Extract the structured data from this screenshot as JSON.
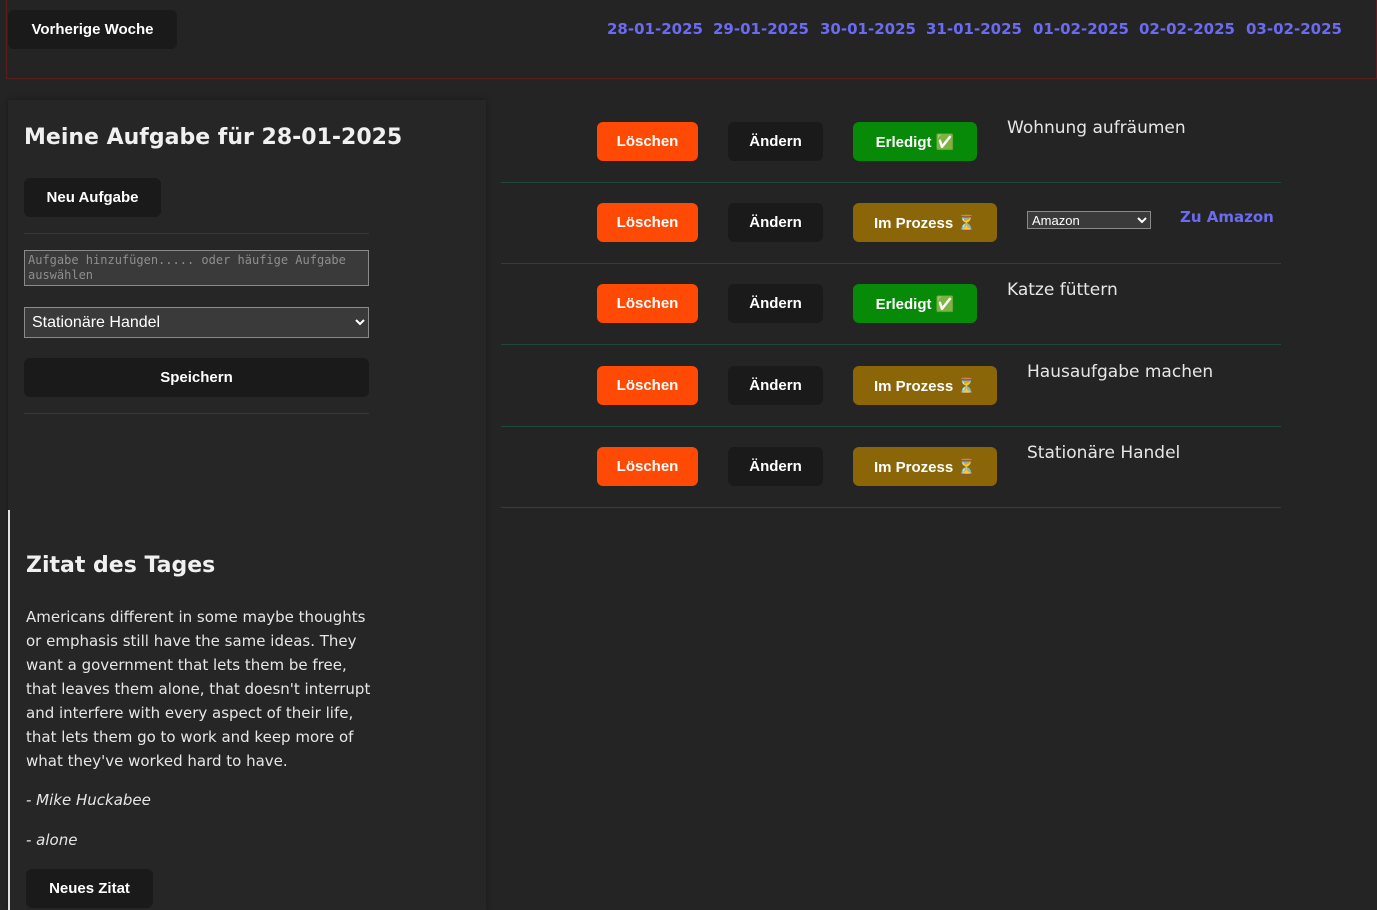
{
  "nav": {
    "prev_week_label": "Vorherige Woche",
    "dates": [
      "28-01-2025",
      "29-01-2025",
      "30-01-2025",
      "31-01-2025",
      "01-02-2025",
      "02-02-2025",
      "03-02-2025"
    ]
  },
  "sidebar": {
    "title": "Meine Aufgabe für 28-01-2025",
    "new_task_label": "Neu Aufgabe",
    "textarea_placeholder": "Aufgabe hinzufügen..... oder häufige Aufgabe auswählen",
    "category_selected": "Stationäre Handel",
    "save_label": "Speichern"
  },
  "quote": {
    "heading": "Zitat des Tages",
    "text": "Americans different in some maybe thoughts or emphasis still have the same ideas. They want a government that lets them be free, that leaves them alone, that doesn't interrupt and interfere with every aspect of their life, that lets them go to work and keep more of what they've worked hard to have.",
    "author": "- Mike Huckabee",
    "tag": "- alone",
    "new_quote_label": "Neues Zitat"
  },
  "tasks": [
    {
      "delete_label": "Löschen",
      "edit_label": "Ändern",
      "status": "done",
      "status_label": "Erledigt ✅",
      "name": "Wohnung aufräumen"
    },
    {
      "delete_label": "Löschen",
      "edit_label": "Ändern",
      "status": "in-progress",
      "status_label": "Im Prozess ⏳",
      "select_value": "Amazon",
      "link_label": "Zu Amazon"
    },
    {
      "delete_label": "Löschen",
      "edit_label": "Ändern",
      "status": "done",
      "status_label": "Erledigt ✅",
      "name": "Katze füttern"
    },
    {
      "delete_label": "Löschen",
      "edit_label": "Ändern",
      "status": "in-progress",
      "status_label": "Im Prozess ⏳",
      "name": "Hausaufgabe machen"
    },
    {
      "delete_label": "Löschen",
      "edit_label": "Ändern",
      "status": "in-progress",
      "status_label": "Im Prozess ⏳",
      "name": "Stationäre Handel"
    }
  ],
  "colors": {
    "background": "#242424",
    "delete": "#ff4a05",
    "done": "#078a07",
    "in_progress": "#8a6608",
    "link": "#6b6bf2",
    "divider": "#1f4a3a"
  }
}
